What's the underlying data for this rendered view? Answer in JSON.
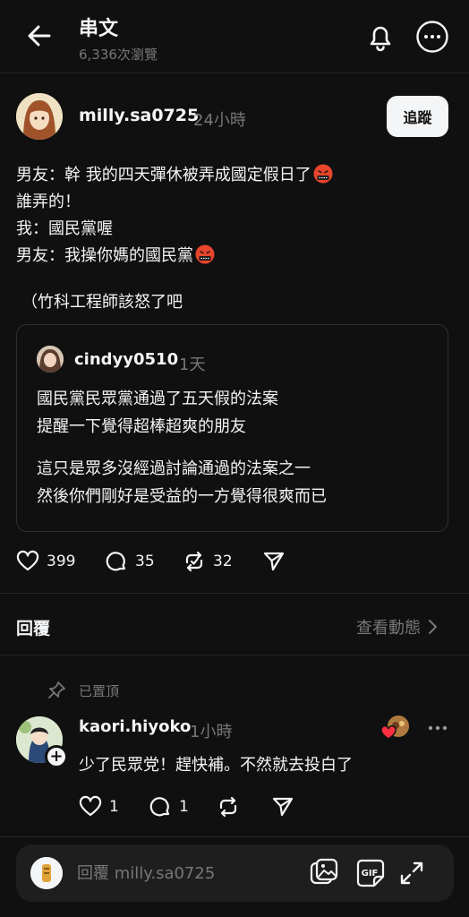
{
  "header": {
    "title": "串文",
    "views": "6,336次瀏覽",
    "back_icon": "arrow-left-icon",
    "bell_icon": "bell-icon",
    "more_icon": "more-circle-icon"
  },
  "post": {
    "author": "milly.sa0725",
    "time": "24小時",
    "follow_label": "追蹤",
    "lines": [
      "男友：幹 我的四天彈休被弄成國定假日了",
      "誰弄的！",
      "我：國民黨喔",
      "男友：我操你媽的國民黨"
    ],
    "tail": "（竹科工程師該怒了吧",
    "emoji": "cursing-face-emoji"
  },
  "quote": {
    "author": "cindyy0510",
    "time": "1天",
    "para1": [
      "國民黨民眾黨通過了五天假的法案",
      "提醒一下覺得超棒超爽的朋友"
    ],
    "para2": [
      "這只是眾多沒經過討論通過的法案之一",
      "然後你們剛好是受益的一方覺得很爽而已"
    ]
  },
  "actions": {
    "likes": "399",
    "comments": "35",
    "reposts": "32"
  },
  "replies": {
    "label": "回覆",
    "activity_link": "查看動態",
    "pinned_label": "已置頂"
  },
  "comment": {
    "author": "kaori.hiyoko",
    "time": "1小時",
    "text": "少了民眾党！趕快補。不然就去投白了",
    "likes": "1",
    "comments": "1"
  },
  "composer": {
    "placeholder": "回覆 milly.sa0725"
  },
  "colors": {
    "background": "#101010",
    "text": "#f3f5f7",
    "secondary": "#777777",
    "divider": "#262626",
    "like_red": "#ff3040"
  }
}
